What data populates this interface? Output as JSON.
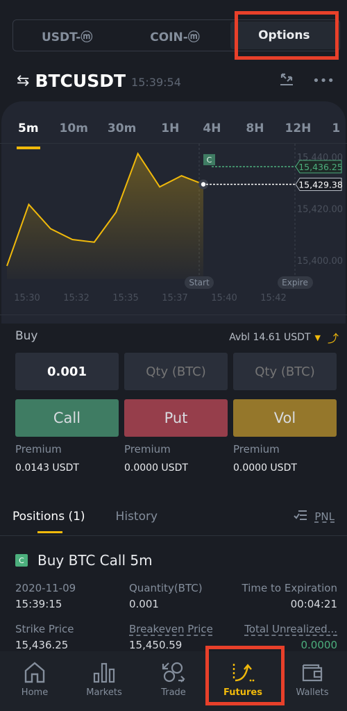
{
  "top_tabs": [
    {
      "label": "USDT-ⓜ",
      "active": false
    },
    {
      "label": "COIN-ⓜ",
      "active": false
    },
    {
      "label": "Options",
      "active": true
    }
  ],
  "symbol": {
    "name": "BTCUSDT",
    "time": "15:39:54",
    "swap_icon": "swap-arrows-icon",
    "transfer_icon": "transfer-icon",
    "more_icon": "more-dots-icon"
  },
  "intervals": [
    "5m",
    "10m",
    "30m",
    "1H",
    "4H",
    "8H",
    "12H",
    "1"
  ],
  "active_interval": "5m",
  "chart_data": {
    "type": "area",
    "x": [
      "15:30",
      "15:31",
      "15:32",
      "15:33",
      "15:34",
      "15:35",
      "15:36",
      "15:37",
      "15:38",
      "15:39"
    ],
    "values": [
      15397.8,
      15421.6,
      15412.2,
      15408.0,
      15407.0,
      15418.6,
      15441.3,
      15428.4,
      15432.7,
      15429.4
    ],
    "x_ticks": [
      "15:30",
      "15:32",
      "15:35",
      "15:37",
      "15:40",
      "15:42"
    ],
    "y_ticks": [
      "15,440.00",
      "15,420.00",
      "15,400.00"
    ],
    "ylim": [
      15395,
      15444
    ],
    "strike_price": 15436.25,
    "strike_label": "15,436.25",
    "current_price": 15429.38,
    "current_label": "15,429.38",
    "strike_marker": "C",
    "start_label": "Start",
    "expire_label": "Expire",
    "line_color": "#f0b90b",
    "strike_color": "#4caf7d"
  },
  "buy": {
    "label": "Buy",
    "avbl": "Avbl 14.61 USDT",
    "qty_inputs": [
      {
        "value": "0.001",
        "placeholder": "Qty (BTC)"
      },
      {
        "value": "",
        "placeholder": "Qty (BTC)"
      },
      {
        "value": "",
        "placeholder": "Qty (BTC)"
      }
    ],
    "buttons": [
      {
        "label": "Call",
        "color": "#3f7c63"
      },
      {
        "label": "Put",
        "color": "#963e4b"
      },
      {
        "label": "Vol",
        "color": "#95772b"
      }
    ],
    "premiums": [
      {
        "label": "Premium",
        "value": "0.0143 USDT"
      },
      {
        "label": "Premium",
        "value": "0.0000 USDT"
      },
      {
        "label": "Premium",
        "value": "0.0000 USDT"
      }
    ]
  },
  "positions_tabs": {
    "positions": "Positions (1)",
    "history": "History",
    "pnl": "PNL"
  },
  "position": {
    "badge": "C",
    "title": "Buy BTC Call 5m",
    "date": "2020-11-09",
    "time": "15:39:15",
    "qty_label": "Quantity(BTC)",
    "qty_value": "0.001",
    "tte_label": "Time to Expiration",
    "tte_value": "00:04:21",
    "strike_label": "Strike Price",
    "strike_value": "15,436.25",
    "breakeven_label": "Breakeven Price",
    "breakeven_value": "15,450.59",
    "unrealized_label": "Total Unrealized...",
    "unrealized_value": "0.0000",
    "unrealized_color": "#4caf7d"
  },
  "nav": [
    {
      "label": "Home",
      "icon": "home-icon",
      "active": false
    },
    {
      "label": "Markets",
      "icon": "markets-icon",
      "active": false
    },
    {
      "label": "Trade",
      "icon": "trade-icon",
      "active": false
    },
    {
      "label": "Futures",
      "icon": "futures-icon",
      "active": true
    },
    {
      "label": "Wallets",
      "icon": "wallet-icon",
      "active": false
    }
  ]
}
